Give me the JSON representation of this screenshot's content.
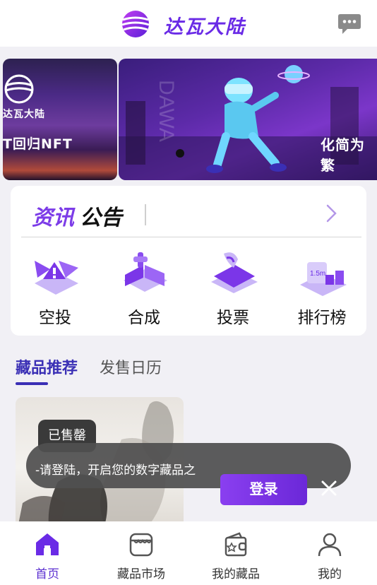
{
  "header": {
    "title": "达瓦大陆"
  },
  "banner": {
    "left_slide_brand": "达瓦大陆",
    "left_slide_caption": "T回归NFT",
    "main_slide_caption": "化简为繁"
  },
  "news": {
    "title_part1": "资讯",
    "title_part2": "公告"
  },
  "features": [
    {
      "label": "空投",
      "icon": "airdrop-icon"
    },
    {
      "label": "合成",
      "icon": "synthesis-icon"
    },
    {
      "label": "投票",
      "icon": "vote-icon"
    },
    {
      "label": "排行榜",
      "icon": "leaderboard-icon"
    }
  ],
  "tabs": {
    "active": "藏品推荐",
    "inactive": "发售日历"
  },
  "product": {
    "status": "已售罄"
  },
  "toast": {
    "message": "-请登陆，开启您的数字藏品之",
    "login_label": "登录"
  },
  "bottom_nav": [
    {
      "label": "首页",
      "icon": "home-icon"
    },
    {
      "label": "藏品市场",
      "icon": "market-icon"
    },
    {
      "label": "我的藏品",
      "icon": "wallet-icon"
    },
    {
      "label": "我的",
      "icon": "user-icon"
    }
  ],
  "colors": {
    "accent": "#6a2be6",
    "tab_active": "#3a2fb5",
    "toast_bg": "#505050"
  }
}
